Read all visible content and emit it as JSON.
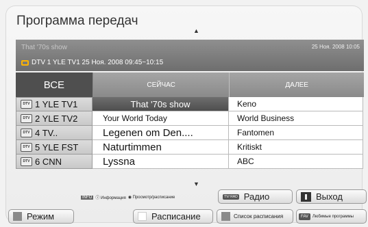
{
  "header": {
    "title": "Программа передач"
  },
  "info": {
    "program": "That '70s show",
    "datetime": "25 Ноя. 2008 10:05",
    "channel_line": "DTV  1 YLE TV1 25 Ноя. 2008 09:45~10:15"
  },
  "columns": {
    "all": "ВСЕ",
    "now": "СЕЙЧАС",
    "next": "ДАЛЕЕ"
  },
  "rows": [
    {
      "icon": "DTV",
      "channel": "1  YLE TV1",
      "now": "That '70s show",
      "next": "Keno",
      "selected": true
    },
    {
      "icon": "DTV",
      "channel": "2  YLE TV2",
      "now": "Your World Today",
      "next": "World Business"
    },
    {
      "icon": "DTV",
      "channel": "4  TV..",
      "now": "Legenen om Den....",
      "next": "Fantomen"
    },
    {
      "icon": "DTV",
      "channel": "5  YLE FST",
      "now": "Naturtimmen",
      "next": "Kritiskt"
    },
    {
      "icon": "DTV",
      "channel": "6  CNN",
      "now": "Lyssna",
      "next": "ABC"
    }
  ],
  "legend": {
    "info_key": "INFO",
    "info_label": "ⓘ Информация",
    "view_label": "◉ Просмотр/расписание"
  },
  "buttons": {
    "mode": "Режим",
    "schedule": "Расписание",
    "schedule_list": "Список расписания",
    "fav_key": "FAV",
    "favorites": "Любимые программы",
    "radio_key": "TV/ RAD",
    "radio": "Радио",
    "exit": "Выход"
  },
  "colors": {
    "selected": "#555555",
    "header_all": "#4f4f4f",
    "accent": "#ffb400"
  }
}
